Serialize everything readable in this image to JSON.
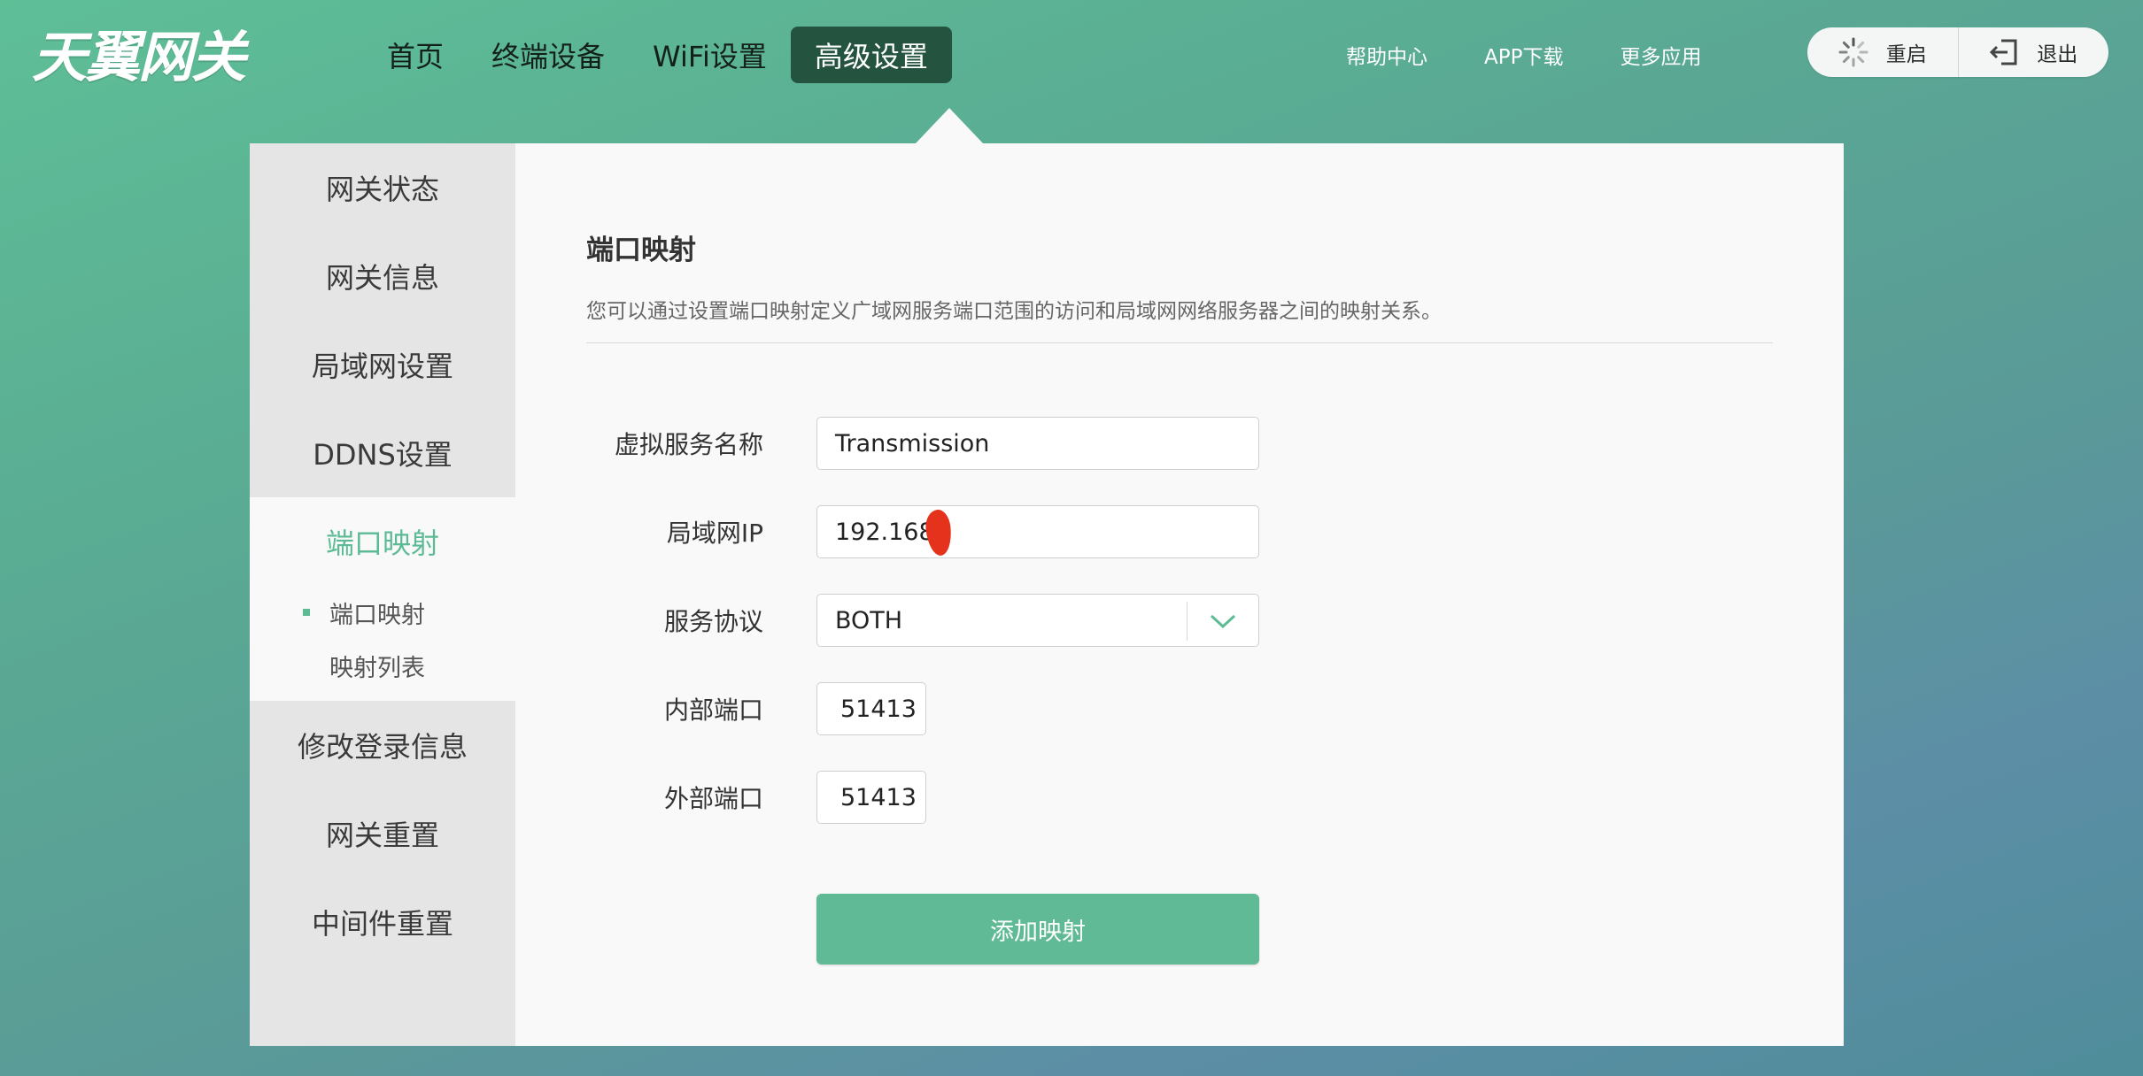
{
  "brand": {
    "logo_text": "天翼网关"
  },
  "nav": {
    "items": [
      {
        "label": "首页",
        "active": false
      },
      {
        "label": "终端设备",
        "active": false
      },
      {
        "label": "WiFi设置",
        "active": false
      },
      {
        "label": "高级设置",
        "active": true
      }
    ]
  },
  "header_links": {
    "help": "帮助中心",
    "app": "APP下载",
    "more": "更多应用"
  },
  "actions": {
    "restart": "重启",
    "logout": "退出"
  },
  "sidebar": {
    "items_top": [
      "网关状态",
      "网关信息",
      "局域网设置",
      "DDNS设置"
    ],
    "group_active": "端口映射",
    "sub_items": [
      "端口映射",
      "映射列表"
    ],
    "items_bottom": [
      "修改登录信息",
      "网关重置",
      "中间件重置"
    ]
  },
  "content": {
    "title": "端口映射",
    "description": "您可以通过设置端口映射定义广域网服务端口范围的访问和局域网网络服务器之间的映射关系。"
  },
  "form": {
    "service_name_label": "虚拟服务名称",
    "service_name_value": "Transmission",
    "lan_ip_label": "局域网IP",
    "lan_ip_value": "192.168.",
    "protocol_label": "服务协议",
    "protocol_value": "BOTH",
    "internal_port_label": "内部端口",
    "internal_port_value": "51413",
    "external_port_label": "外部端口",
    "external_port_value": "51413",
    "submit_label": "添加映射"
  },
  "colors": {
    "accent": "#5cbb94",
    "nav_active": "#24533f",
    "redaction": "#e5321c"
  }
}
